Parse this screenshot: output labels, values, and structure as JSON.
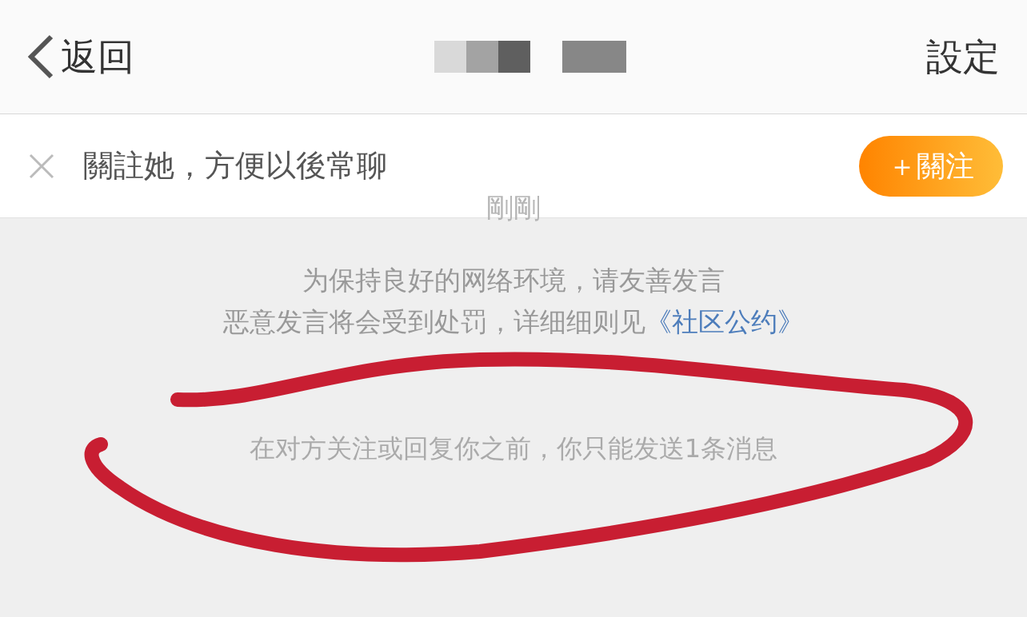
{
  "header": {
    "back_label": "返回",
    "settings": "設定"
  },
  "follow_bar": {
    "prompt": "關註她，方便以後常聊",
    "button": "＋關注"
  },
  "timestamp": "剛剛",
  "notice": {
    "line1": "为保持良好的网络环境，请友善发言",
    "line2": "恶意发言将会受到处罚，详细细则见",
    "link": "《社区公约》"
  },
  "limit_message": "在对方关注或回复你之前，你只能发送1条消息"
}
